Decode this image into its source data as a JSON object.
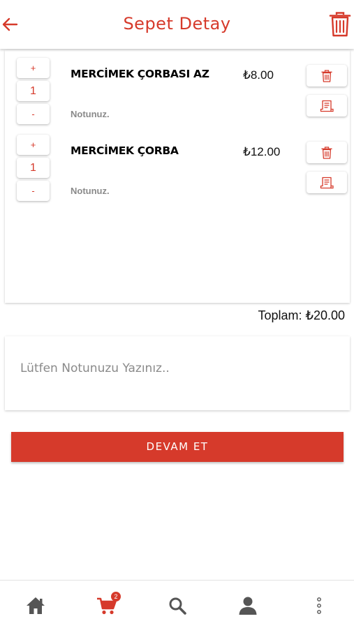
{
  "header": {
    "title": "Sepet Detay",
    "back_icon": "arrow-left-icon",
    "action_icon": "trash-icon"
  },
  "colors": {
    "accent": "#d63a2b",
    "muted_text": "#8a8a8a",
    "nav_icon": "#555555"
  },
  "cart": {
    "items": [
      {
        "plus_label": "+",
        "quantity": "1",
        "minus_label": "-",
        "name": "MERCİMEK ÇORBASI AZ",
        "price": "₺8.00",
        "note": "Notunuz."
      },
      {
        "plus_label": "+",
        "quantity": "1",
        "minus_label": "-",
        "name": "MERCİMEK ÇORBA",
        "price": "₺12.00",
        "note": "Notunuz."
      }
    ],
    "total": "Toplam: ₺20.00"
  },
  "note": {
    "placeholder": "Lütfen Notunuzu Yazınız.."
  },
  "continue_label": "DEVAM ET",
  "bottom_nav": {
    "items": [
      {
        "icon": "home-icon"
      },
      {
        "icon": "cart-icon",
        "badge": "2"
      },
      {
        "icon": "search-icon"
      },
      {
        "icon": "user-icon"
      },
      {
        "icon": "more-vertical-icon"
      }
    ]
  }
}
